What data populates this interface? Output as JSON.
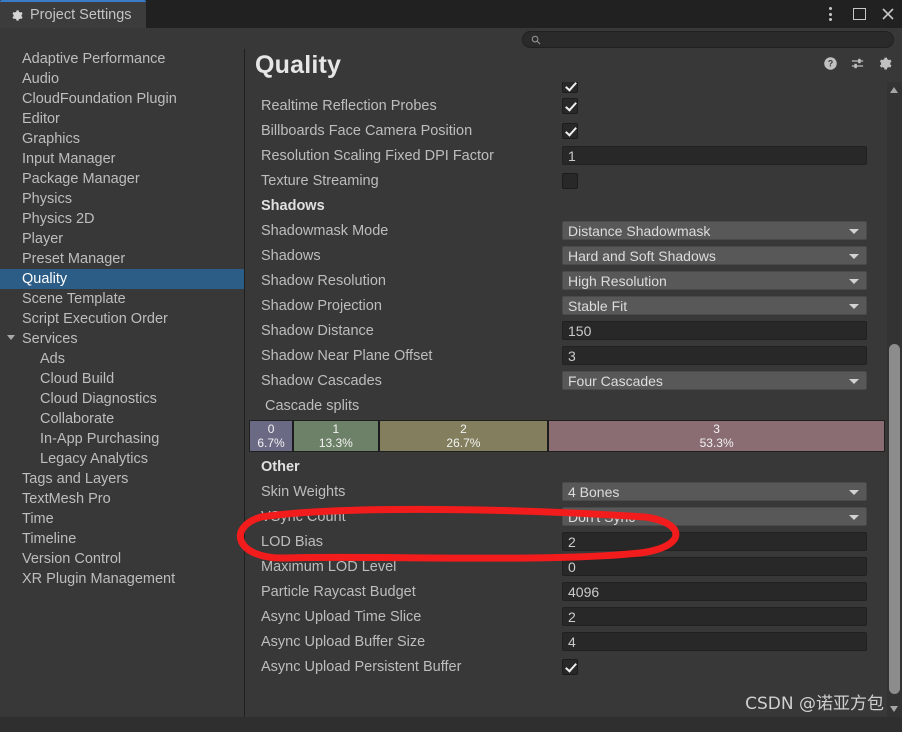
{
  "window": {
    "tab_label": "Project Settings",
    "tab_icon": "gear-icon",
    "controls": {
      "menu_icon": "kebab-menu-icon",
      "maximize_icon": "maximize-icon",
      "close_icon": "close-icon"
    },
    "accent_color": "#3a7bc8"
  },
  "search": {
    "icon": "search-icon",
    "value": "",
    "placeholder": ""
  },
  "sidebar": {
    "items": [
      {
        "label": "Adaptive Performance",
        "level": 0,
        "selected": false
      },
      {
        "label": "Audio",
        "level": 0,
        "selected": false
      },
      {
        "label": "CloudFoundation Plugin",
        "level": 0,
        "selected": false
      },
      {
        "label": "Editor",
        "level": 0,
        "selected": false
      },
      {
        "label": "Graphics",
        "level": 0,
        "selected": false
      },
      {
        "label": "Input Manager",
        "level": 0,
        "selected": false
      },
      {
        "label": "Package Manager",
        "level": 0,
        "selected": false
      },
      {
        "label": "Physics",
        "level": 0,
        "selected": false
      },
      {
        "label": "Physics 2D",
        "level": 0,
        "selected": false
      },
      {
        "label": "Player",
        "level": 0,
        "selected": false
      },
      {
        "label": "Preset Manager",
        "level": 0,
        "selected": false
      },
      {
        "label": "Quality",
        "level": 0,
        "selected": true
      },
      {
        "label": "Scene Template",
        "level": 0,
        "selected": false
      },
      {
        "label": "Script Execution Order",
        "level": 0,
        "selected": false
      },
      {
        "label": "Services",
        "level": 0,
        "selected": false,
        "expandable": true,
        "expanded": true
      },
      {
        "label": "Ads",
        "level": 1,
        "selected": false
      },
      {
        "label": "Cloud Build",
        "level": 1,
        "selected": false
      },
      {
        "label": "Cloud Diagnostics",
        "level": 1,
        "selected": false
      },
      {
        "label": "Collaborate",
        "level": 1,
        "selected": false
      },
      {
        "label": "In-App Purchasing",
        "level": 1,
        "selected": false
      },
      {
        "label": "Legacy Analytics",
        "level": 1,
        "selected": false
      },
      {
        "label": "Tags and Layers",
        "level": 0,
        "selected": false
      },
      {
        "label": "TextMesh Pro",
        "level": 0,
        "selected": false
      },
      {
        "label": "Time",
        "level": 0,
        "selected": false
      },
      {
        "label": "Timeline",
        "level": 0,
        "selected": false
      },
      {
        "label": "Version Control",
        "level": 0,
        "selected": false
      },
      {
        "label": "XR Plugin Management",
        "level": 0,
        "selected": false
      }
    ],
    "selected_color": "#2c5d87"
  },
  "main": {
    "title": "Quality",
    "header_icons": [
      {
        "name": "help-icon"
      },
      {
        "name": "preset-icon"
      },
      {
        "name": "settings-gear-icon"
      }
    ],
    "rows": [
      {
        "type": "checkbox",
        "label": "",
        "value": true,
        "partial": true
      },
      {
        "type": "checkbox",
        "label": "Realtime Reflection Probes",
        "value": true
      },
      {
        "type": "checkbox",
        "label": "Billboards Face Camera Position",
        "value": true
      },
      {
        "type": "field",
        "label": "Resolution Scaling Fixed DPI Factor",
        "value": "1"
      },
      {
        "type": "checkbox",
        "label": "Texture Streaming",
        "value": false
      },
      {
        "type": "section",
        "label": "Shadows"
      },
      {
        "type": "dropdown",
        "label": "Shadowmask Mode",
        "value": "Distance Shadowmask"
      },
      {
        "type": "dropdown",
        "label": "Shadows",
        "value": "Hard and Soft Shadows"
      },
      {
        "type": "dropdown",
        "label": "Shadow Resolution",
        "value": "High Resolution"
      },
      {
        "type": "dropdown",
        "label": "Shadow Projection",
        "value": "Stable Fit"
      },
      {
        "type": "field",
        "label": "Shadow Distance",
        "value": "150"
      },
      {
        "type": "field",
        "label": "Shadow Near Plane Offset",
        "value": "3"
      },
      {
        "type": "dropdown",
        "label": "Shadow Cascades",
        "value": "Four Cascades"
      },
      {
        "type": "sublabel",
        "label": "Cascade splits"
      },
      {
        "type": "cascade"
      },
      {
        "type": "section",
        "label": "Other"
      },
      {
        "type": "dropdown",
        "label": "Skin Weights",
        "value": "4 Bones"
      },
      {
        "type": "dropdown",
        "label": "VSync Count",
        "value": "Don't Sync",
        "annotated": true
      },
      {
        "type": "field",
        "label": "LOD Bias",
        "value": "2"
      },
      {
        "type": "field",
        "label": "Maximum LOD Level",
        "value": "0"
      },
      {
        "type": "field",
        "label": "Particle Raycast Budget",
        "value": "4096"
      },
      {
        "type": "field",
        "label": "Async Upload Time Slice",
        "value": "2"
      },
      {
        "type": "field",
        "label": "Async Upload Buffer Size",
        "value": "4"
      },
      {
        "type": "checkbox",
        "label": "Async Upload Persistent Buffer",
        "value": true
      }
    ]
  },
  "cascade_splits": {
    "segments": [
      {
        "index": "0",
        "percent": "6.7%",
        "value": 6.7,
        "color": "#6b6a85"
      },
      {
        "index": "1",
        "percent": "13.3%",
        "value": 13.3,
        "color": "#6d8068"
      },
      {
        "index": "2",
        "percent": "26.7%",
        "value": 26.7,
        "color": "#837f5e"
      },
      {
        "index": "3",
        "percent": "53.3%",
        "value": 53.3,
        "color": "#8a6d72"
      }
    ]
  },
  "annotation": {
    "shape": "hand-drawn-ellipse",
    "color": "#f21c1c",
    "target": "VSync Count"
  },
  "watermark": {
    "text": "CSDN @诺亚方包"
  },
  "scrollbar": {
    "up_icon": "scroll-up-arrow-icon",
    "down_icon": "scroll-down-arrow-icon"
  }
}
